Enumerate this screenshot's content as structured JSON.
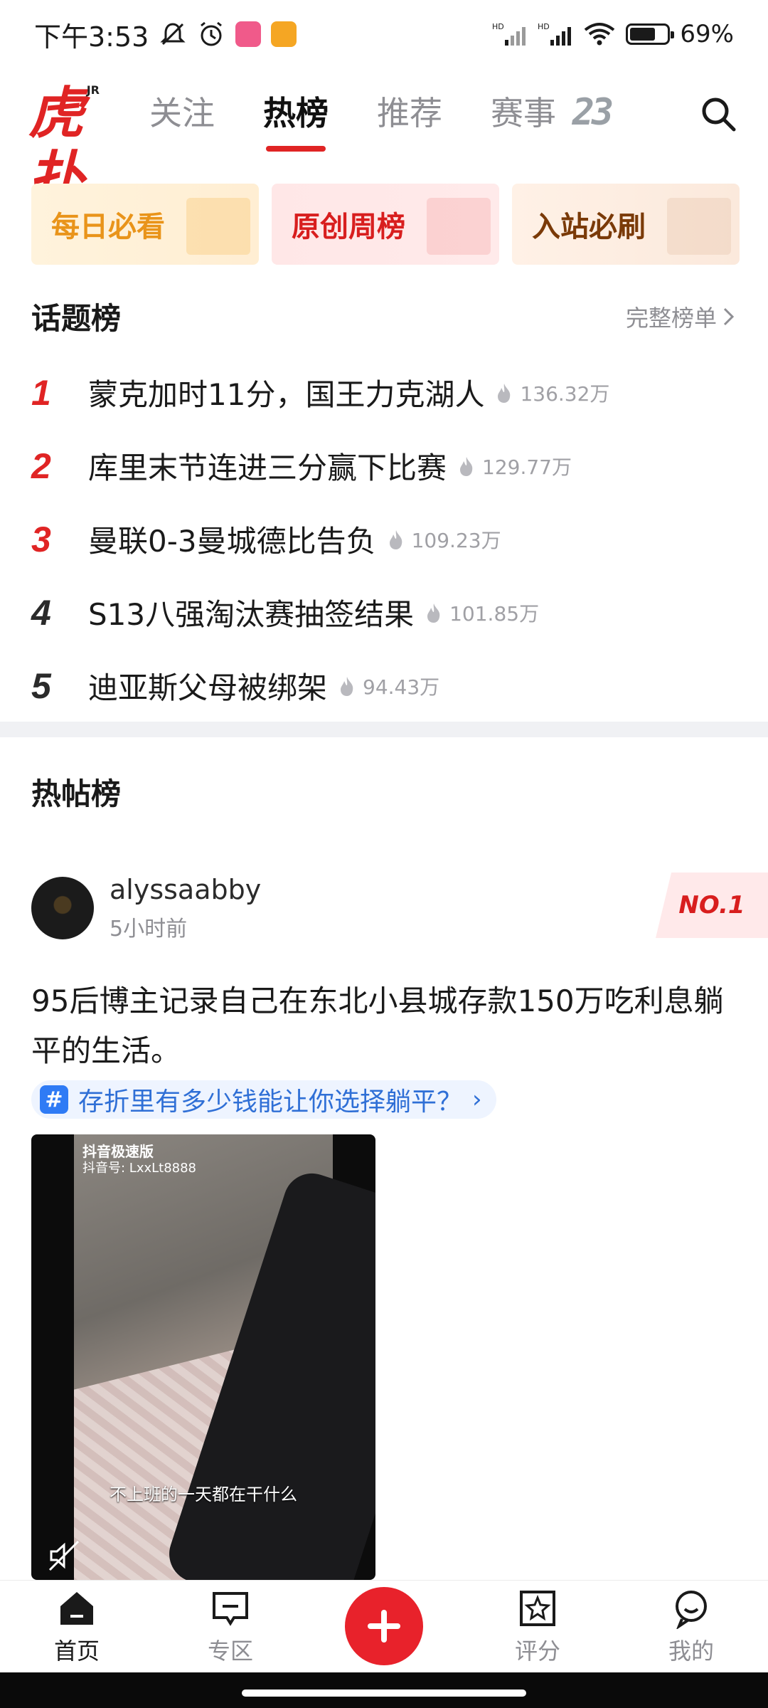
{
  "status_bar": {
    "time": "下午3:53",
    "battery": "69%",
    "battery_level": 0.69
  },
  "top_nav": {
    "logo_main": "虎扑",
    "logo_sub": "JR",
    "tabs": [
      {
        "label": "关注",
        "active": false
      },
      {
        "label": "热榜",
        "active": true
      },
      {
        "label": "推荐",
        "active": false
      },
      {
        "label": "赛事",
        "active": false,
        "badge": "23"
      }
    ]
  },
  "feature_cards": [
    {
      "label": "每日必看"
    },
    {
      "label": "原创周榜"
    },
    {
      "label": "入站必刷"
    }
  ],
  "topic_board": {
    "title": "话题榜",
    "more_label": "完整榜单",
    "items": [
      {
        "rank": "1",
        "title": "蒙克加时11分，国王力克湖人",
        "heat": "136.32万"
      },
      {
        "rank": "2",
        "title": "库里末节连进三分赢下比赛",
        "heat": "129.77万"
      },
      {
        "rank": "3",
        "title": "曼联0-3曼城德比告负",
        "heat": "109.23万"
      },
      {
        "rank": "4",
        "title": "S13八强淘汰赛抽签结果",
        "heat": "101.85万"
      },
      {
        "rank": "5",
        "title": "迪亚斯父母被绑架",
        "heat": "94.43万"
      }
    ]
  },
  "hot_posts": {
    "title": "热帖榜",
    "post": {
      "author": "alyssaabby",
      "time": "5小时前",
      "rank_badge": "NO.1",
      "title": "95后博主记录自己在东北小县城存款150万吃利息躺平的生活。",
      "topic": "存折里有多少钱能让你选择躺平？",
      "video": {
        "watermark_app": "抖音极速版",
        "watermark_id": "抖音号: LxxLt8888",
        "caption": "不上班的一天都在干什么"
      }
    }
  },
  "tabbar": {
    "items": [
      {
        "label": "首页",
        "icon": "home-icon",
        "active": true
      },
      {
        "label": "专区",
        "icon": "zone-icon",
        "active": false
      },
      {
        "label": "",
        "icon": "plus-icon",
        "active": false
      },
      {
        "label": "评分",
        "icon": "rating-icon",
        "active": false
      },
      {
        "label": "我的",
        "icon": "profile-icon",
        "active": false
      }
    ]
  },
  "colors": {
    "brand_red": "#e02424",
    "accent_blue": "#2f7bf5"
  }
}
